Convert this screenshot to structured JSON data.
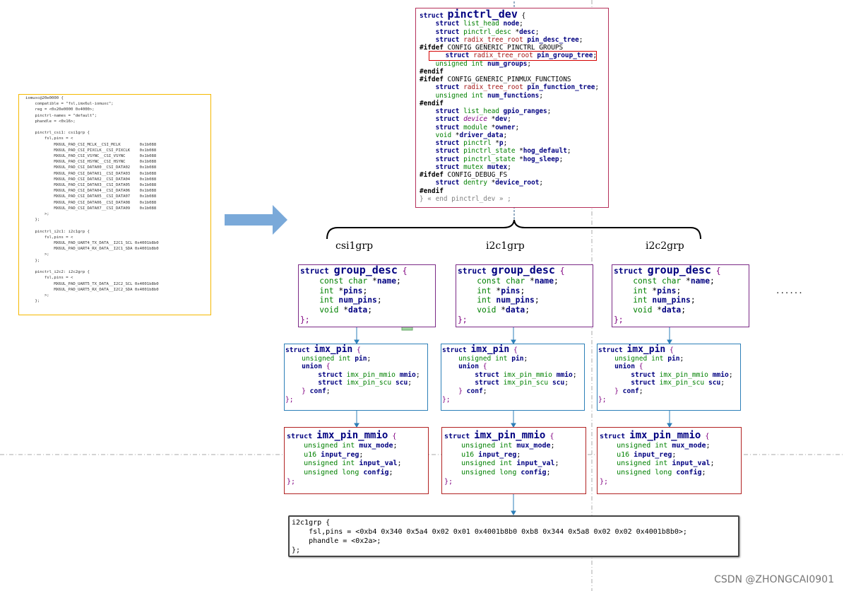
{
  "dts": {
    "lines": [
      "iomuxc@20e0000 {",
      "    compatible = \"fsl,imx6ul-iomuxc\";",
      "    reg = <0x20e0000 0x4000>;",
      "    pinctrl-names = \"default\";",
      "    phandle = <0x16>;",
      "",
      "    pinctrl_csi1: csi1grp {",
      "        fsl,pins = <",
      "            MX6UL_PAD_CSI_MCLK__CSI_MCLK        0x1b088",
      "            MX6UL_PAD_CSI_PIXCLK__CSI_PIXCLK    0x1b088",
      "            MX6UL_PAD_CSI_VSYNC__CSI_VSYNC      0x1b088",
      "            MX6UL_PAD_CSI_HSYNC__CSI_HSYNC      0x1b088",
      "            MX6UL_PAD_CSI_DATA00__CSI_DATA02    0x1b088",
      "            MX6UL_PAD_CSI_DATA01__CSI_DATA03    0x1b088",
      "            MX6UL_PAD_CSI_DATA02__CSI_DATA04    0x1b088",
      "            MX6UL_PAD_CSI_DATA03__CSI_DATA05    0x1b088",
      "            MX6UL_PAD_CSI_DATA04__CSI_DATA06    0x1b088",
      "            MX6UL_PAD_CSI_DATA05__CSI_DATA07    0x1b088",
      "            MX6UL_PAD_CSI_DATA06__CSI_DATA08    0x1b088",
      "            MX6UL_PAD_CSI_DATA07__CSI_DATA09    0x1b088",
      "        >;",
      "    };",
      "",
      "    pinctrl_i2c1: i2c1grp {",
      "        fsl,pins = <",
      "            MX6UL_PAD_UART4_TX_DATA__I2C1_SCL 0x4001b8b0",
      "            MX6UL_PAD_UART4_RX_DATA__I2C1_SDA 0x4001b8b0",
      "        >;",
      "    };",
      "",
      "    pinctrl_i2c2: i2c2grp {",
      "        fsl,pins = <",
      "            MX6UL_PAD_UART5_TX_DATA__I2C2_SCL 0x4001b8b0",
      "            MX6UL_PAD_UART5_RX_DATA__I2C2_SDA 0x4001b8b0",
      "        >;",
      "    };"
    ]
  },
  "pinctrl_dev": {
    "l01": "struct ",
    "l01b": "pinctrl_dev",
    "l01c": " {",
    "l02a": "    struct ",
    "l02b": "list_head",
    "l02c": " node",
    "l03a": "    struct ",
    "l03b": "pinctrl_desc",
    "l03c": " *",
    "l03d": "desc",
    "l04a": "    struct ",
    "l04b": "radix_tree_root",
    "l04c": " pin_desc_tree",
    "l05": "#ifdef",
    "l05b": " CONFIG_GENERIC_PINCTRL_GROUPS",
    "l06a": "    struct ",
    "l06b": "radix_tree_root",
    "l06c": " pin_group_tree",
    "l07a": "    unsigned int",
    "l07b": " num_groups",
    "l08": "#endif",
    "l09": "#ifdef",
    "l09b": " CONFIG_GENERIC_PINMUX_FUNCTIONS",
    "l10a": "    struct ",
    "l10b": "radix_tree_root",
    "l10c": " pin_function_tree",
    "l11a": "    unsigned int",
    "l11b": " num_functions",
    "l12": "#endif",
    "l13a": "    struct ",
    "l13b": "list_head",
    "l13c": " gpio_ranges",
    "l14a": "    struct ",
    "l14b": "device",
    "l14c": " *",
    "l14d": "dev",
    "l15a": "    struct ",
    "l15b": "module",
    "l15c": " *",
    "l15d": "owner",
    "l16a": "    void",
    "l16b": " *",
    "l16c": "driver_data",
    "l17a": "    struct ",
    "l17b": "pinctrl",
    "l17c": " *",
    "l17d": "p",
    "l18a": "    struct ",
    "l18b": "pinctrl_state",
    "l18c": " *",
    "l18d": "hog_default",
    "l19a": "    struct ",
    "l19b": "pinctrl_state",
    "l19c": " *",
    "l19d": "hog_sleep",
    "l20a": "    struct ",
    "l20b": "mutex",
    "l20c": " mutex",
    "l21": "#ifdef",
    "l21b": " CONFIG_DEBUG_FS",
    "l22a": "    struct ",
    "l22b": "dentry",
    "l22c": " *",
    "l22d": "device_root",
    "l23": "#endif",
    "l24": "} « end pinctrl_dev » ;"
  },
  "groups": [
    {
      "label": "csi1grp"
    },
    {
      "label": "i2c1grp"
    },
    {
      "label": "i2c2grp"
    }
  ],
  "group_desc": {
    "kw": "struct ",
    "name": "group_desc",
    "open": " {",
    "f1a": "    const char",
    "f1b": " *",
    "f1c": "name",
    "f2a": "    int",
    "f2b": " *",
    "f2c": "pins",
    "f3a": "    int",
    "f3b": " num_pins",
    "f4a": "    void",
    "f4b": " *",
    "f4c": "data",
    "close": "};"
  },
  "imx_pin": {
    "kw": "struct ",
    "name": "imx_pin",
    "open": " {",
    "f1a": "    unsigned int",
    "f1b": " pin",
    "f2": "    union",
    "f2o": " {",
    "f3a": "        struct ",
    "f3b": "imx_pin_mmio",
    "f3c": " mmio",
    "f4a": "        struct ",
    "f4b": "imx_pin_scu",
    "f4c": " scu",
    "f5a": "    }",
    "f5b": " conf",
    "close": "};"
  },
  "imx_pin_mmio": {
    "kw": "struct ",
    "name": "imx_pin_mmio",
    "open": " {",
    "f1a": "    unsigned int",
    "f1b": " mux_mode",
    "f2a": "    u16",
    "f2b": " input_reg",
    "f3a": "    unsigned int",
    "f3b": " input_val",
    "f4a": "    unsigned long",
    "f4b": " config",
    "close": "};"
  },
  "result": {
    "l1": "i2c1grp {",
    "l2": "    fsl,pins = <0xb4 0x340 0x5a4 0x02 0x01 0x4001b8b0 0xb8 0x344 0x5a8 0x02 0x02 0x4001b8b0>;",
    "l3": "    phandle = <0x2a>;",
    "l4": "};"
  },
  "ellipsis": "......",
  "watermark": "CSDN @ZHONGCAI0901",
  "colors": {
    "desc_border": "#b5305a",
    "dts_border": "#f5b800",
    "group_desc_border": "#7b2a86",
    "imx_pin_border": "#2c7fb8",
    "mmio_border": "#b22222",
    "arrow": "#7aa9d9"
  }
}
